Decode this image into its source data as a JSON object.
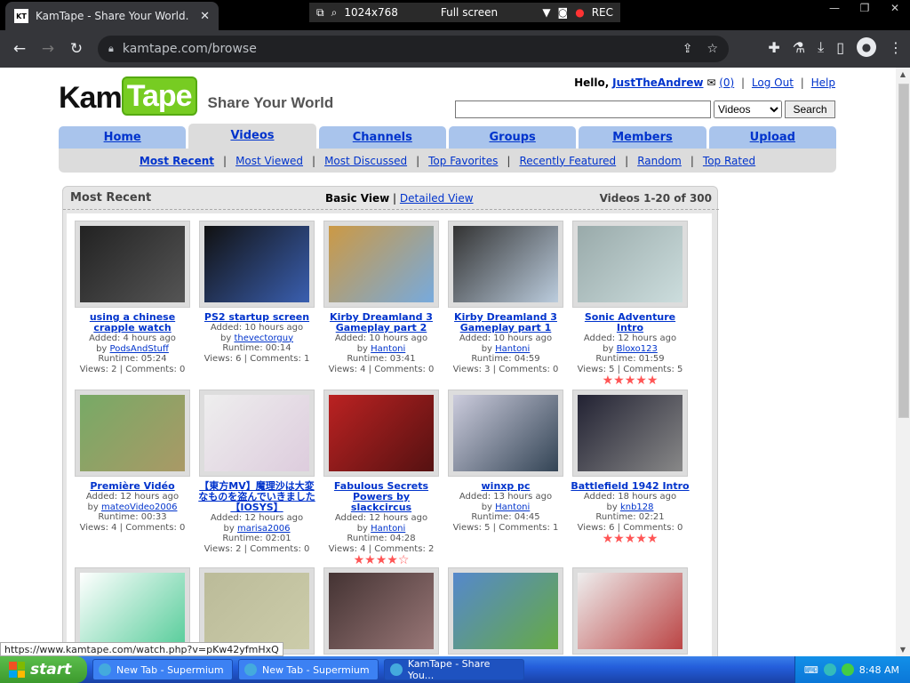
{
  "browser": {
    "tab_title": "KamTape - Share Your World.",
    "tab_icon": "KT",
    "capture": {
      "resolution": "1024x768",
      "mode": "Full screen",
      "rec": "REC"
    },
    "url": "kamtape.com/browse"
  },
  "header": {
    "logo_kam": "Kam",
    "logo_tape": "Tape",
    "tagline": "Share Your World",
    "hello": "Hello,",
    "username": "JustTheAndrew",
    "inbox_count": "(0)",
    "logout": "Log Out",
    "help": "Help",
    "search": {
      "value": "",
      "category": "Videos",
      "button": "Search"
    }
  },
  "tabs": [
    "Home",
    "Videos",
    "Channels",
    "Groups",
    "Members",
    "Upload"
  ],
  "subnav": [
    "Most Recent",
    "Most Viewed",
    "Most Discussed",
    "Top Favorites",
    "Recently Featured",
    "Random",
    "Top Rated"
  ],
  "panel": {
    "title": "Most Recent",
    "basic_view": "Basic View",
    "sep": "|",
    "detailed_view": "Detailed View",
    "count": "Videos 1-20 of 300"
  },
  "labels": {
    "by": "by",
    "sep": "|"
  },
  "videos": [
    {
      "title": "using a chinese crapple watch",
      "added": "Added: 4 hours ago",
      "user": "PodsAndStuff",
      "runtime": "Runtime: 05:24",
      "views": "Views: 2",
      "comments": "Comments: 0",
      "stars": ""
    },
    {
      "title": "PS2 startup screen",
      "added": "Added: 10 hours ago",
      "user": "thevectorguy",
      "runtime": "Runtime: 00:14",
      "views": "Views: 6",
      "comments": "Comments: 1",
      "stars": ""
    },
    {
      "title": "Kirby Dreamland 3 Gameplay part 2",
      "added": "Added: 10 hours ago",
      "user": "Hantoni",
      "runtime": "Runtime: 03:41",
      "views": "Views: 4",
      "comments": "Comments: 0",
      "stars": ""
    },
    {
      "title": "Kirby Dreamland 3 Gameplay part 1",
      "added": "Added: 10 hours ago",
      "user": "Hantoni",
      "runtime": "Runtime: 04:59",
      "views": "Views: 3",
      "comments": "Comments: 0",
      "stars": ""
    },
    {
      "title": "Sonic Adventure Intro",
      "added": "Added: 12 hours ago",
      "user": "Bloxo123",
      "runtime": "Runtime: 01:59",
      "views": "Views: 5",
      "comments": "Comments: 5",
      "stars": "★★★★★"
    },
    {
      "title": "Première Vidéo",
      "added": "Added: 12 hours ago",
      "user": "mateoVideo2006",
      "runtime": "Runtime: 00:33",
      "views": "Views: 4",
      "comments": "Comments: 0",
      "stars": ""
    },
    {
      "title": "【東方MV】魔理沙は大変なものを盗んでいきました【IOSYS】",
      "added": "Added: 12 hours ago",
      "user": "marisa2006",
      "runtime": "Runtime: 02:01",
      "views": "Views: 2",
      "comments": "Comments: 0",
      "stars": ""
    },
    {
      "title": "Fabulous Secrets Powers by slackcircus",
      "added": "Added: 12 hours ago",
      "user": "Hantoni",
      "runtime": "Runtime: 04:28",
      "views": "Views: 4",
      "comments": "Comments: 2",
      "stars": "★★★★☆"
    },
    {
      "title": "winxp pc",
      "added": "Added: 13 hours ago",
      "user": "Hantoni",
      "runtime": "Runtime: 04:45",
      "views": "Views: 5",
      "comments": "Comments: 1",
      "stars": ""
    },
    {
      "title": "Battlefield 1942 Intro",
      "added": "Added: 18 hours ago",
      "user": "knb128",
      "runtime": "Runtime: 02:21",
      "views": "Views: 6",
      "comments": "Comments: 0",
      "stars": "★★★★★"
    },
    {
      "title": "",
      "added": "",
      "user": "",
      "runtime": "",
      "views": "",
      "comments": "",
      "stars": ""
    },
    {
      "title": "",
      "added": "",
      "user": "",
      "runtime": "",
      "views": "",
      "comments": "",
      "stars": ""
    },
    {
      "title": "",
      "added": "",
      "user": "",
      "runtime": "",
      "views": "",
      "comments": "",
      "stars": ""
    },
    {
      "title": "",
      "added": "",
      "user": "",
      "runtime": "",
      "views": "",
      "comments": "",
      "stars": ""
    },
    {
      "title": "",
      "added": "",
      "user": "",
      "runtime": "",
      "views": "",
      "comments": "",
      "stars": ""
    }
  ],
  "status_url": "https://www.kamtape.com/watch.php?v=pKw42yfmHxQ",
  "taskbar": {
    "start": "start",
    "tasks": [
      "New Tab - Supermium",
      "New Tab - Supermium",
      "KamTape - Share You..."
    ],
    "clock": "8:48 AM"
  },
  "colors": {
    "link": "#0033cc",
    "tab_bg": "#a9c4ec",
    "stars": "#ff5555",
    "logo_green": "#77cc22"
  }
}
